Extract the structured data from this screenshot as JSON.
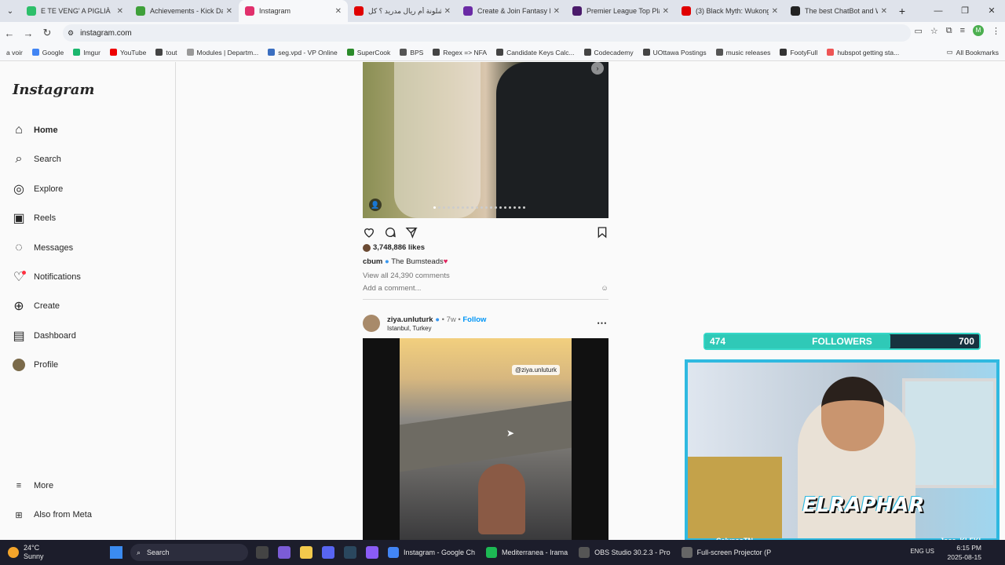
{
  "browser": {
    "tabs": [
      {
        "title": "E TE VENG' A PIGLIÀ",
        "color": "#2dbf6a"
      },
      {
        "title": "Achievements - Kick Dash",
        "color": "#3fa03a"
      },
      {
        "title": "Instagram",
        "color": "#e1306c",
        "active": true
      },
      {
        "title": "برشلونة أم ريال مدريد ؟ كل",
        "color": "#e00000"
      },
      {
        "title": "Create & Join Fantasy Foo",
        "color": "#6a2aa5"
      },
      {
        "title": "Premier League Top Playe",
        "color": "#4a1a6a"
      },
      {
        "title": "(3) Black Myth: Wukong",
        "color": "#e00000"
      },
      {
        "title": "The best ChatBot and Wr",
        "color": "#222"
      }
    ],
    "url": "instagram.com",
    "bookmarks": [
      "a voir",
      "Google",
      "Imgur",
      "YouTube",
      "tout",
      "Modules | Departm...",
      "seg.vpd - VP Online",
      "SuperCook",
      "BPS",
      "Regex => NFA",
      "Candidate Keys Calc...",
      "Codecademy",
      "UOttawa Postings",
      "music releases",
      "FootyFull",
      "hubspot getting sta..."
    ],
    "all_bookmarks": "All Bookmarks"
  },
  "sidebar": {
    "logo": "Instagram",
    "items": [
      {
        "label": "Home",
        "icon": "home-icon"
      },
      {
        "label": "Search",
        "icon": "search-icon"
      },
      {
        "label": "Explore",
        "icon": "explore-icon"
      },
      {
        "label": "Reels",
        "icon": "reels-icon"
      },
      {
        "label": "Messages",
        "icon": "messages-icon"
      },
      {
        "label": "Notifications",
        "icon": "heart-icon"
      },
      {
        "label": "Create",
        "icon": "plus-icon"
      },
      {
        "label": "Dashboard",
        "icon": "dashboard-icon"
      },
      {
        "label": "Profile",
        "icon": "avatar"
      }
    ],
    "more": "More",
    "meta": "Also from Meta"
  },
  "post1": {
    "likes": "3,748,886 likes",
    "author": "cbum",
    "caption": "The Bumsteads",
    "view_all": "View all 24,390 comments",
    "add_comment": "Add a comment..."
  },
  "post2": {
    "author": "ziya.unluturk",
    "age": "7w",
    "follow": "Follow",
    "location": "Istanbul, Turkey",
    "tag": "@ziya.unluturk"
  },
  "stream": {
    "followers_current": "474",
    "followers_label": "FOLLOWERS",
    "followers_goal": "700",
    "progress": 0.677,
    "brand": "ELRAPHAR",
    "left_name": "CalypsoTN",
    "right_name": "Jose_KLFKL"
  },
  "taskbar": {
    "weather_temp": "24°C",
    "weather_desc": "Sunny",
    "search": "Search",
    "apps": [
      "Instagram - Google Ch",
      "Mediterranea - Irama",
      "OBS Studio 30.2.3 - Pro",
      "Full-screen Projector (P"
    ],
    "lang": "ENG US",
    "time": "6:15 PM",
    "date": "2025-08-15"
  }
}
